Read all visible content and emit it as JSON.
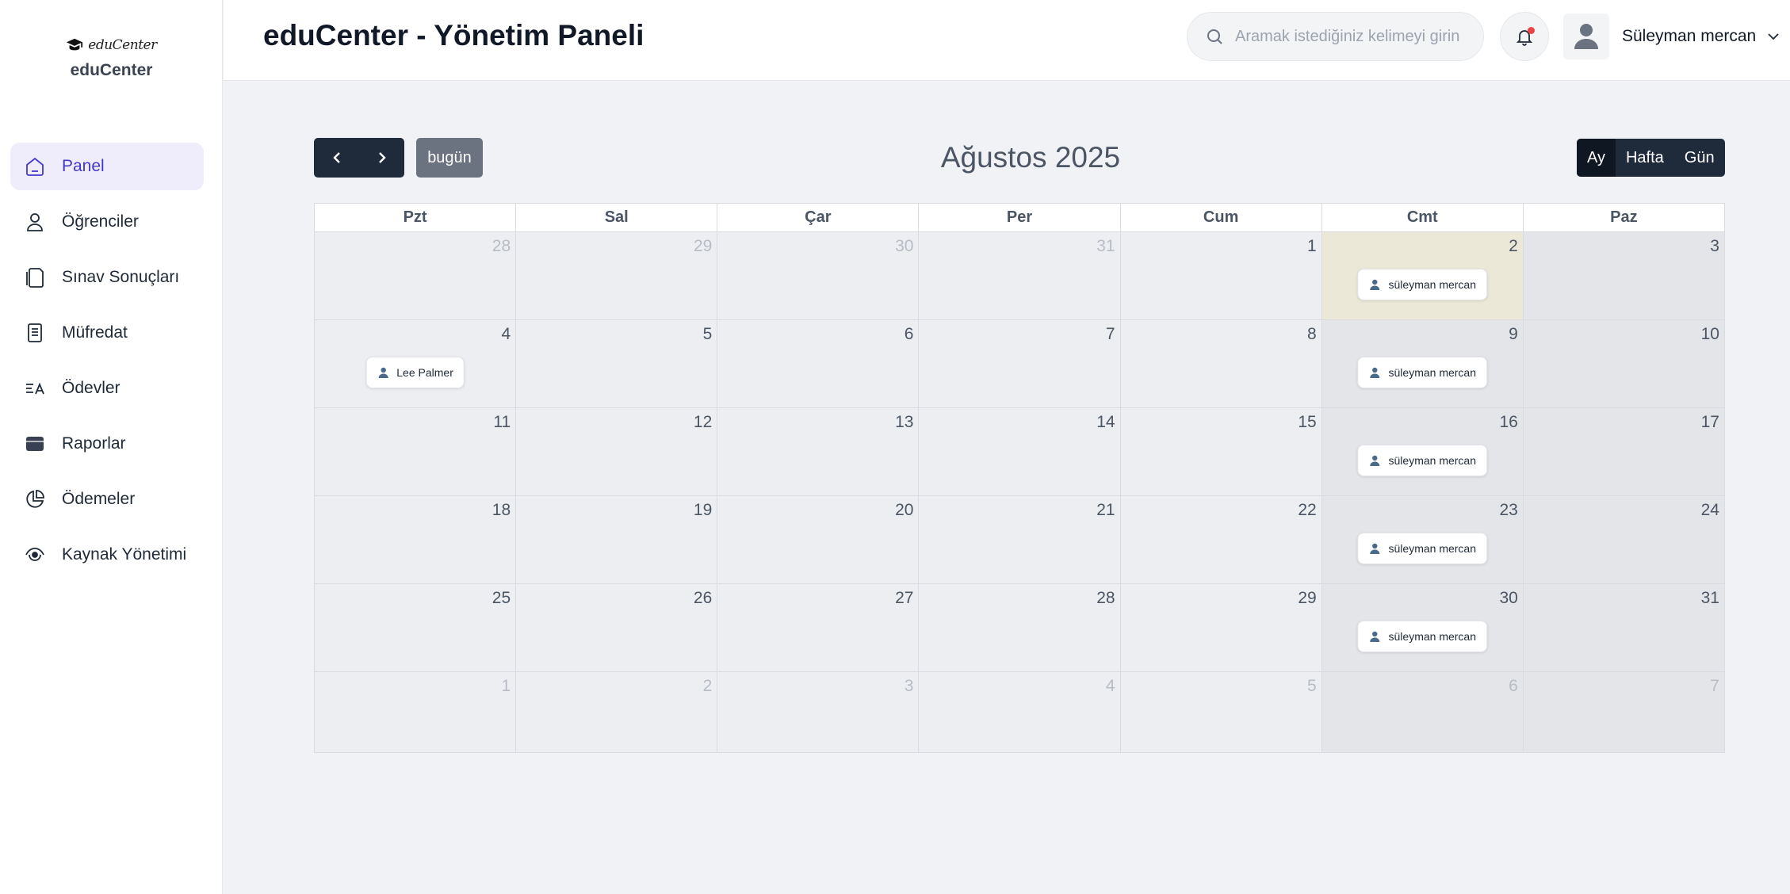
{
  "brand": {
    "script": "eduCenter",
    "name": "eduCenter"
  },
  "sidebar": {
    "items": [
      {
        "label": "Panel",
        "icon": "home-icon",
        "active": true
      },
      {
        "label": "Öğrenciler",
        "icon": "user-icon"
      },
      {
        "label": "Sınav Sonuçları",
        "icon": "clipboard-icon"
      },
      {
        "label": "Müfredat",
        "icon": "document-icon"
      },
      {
        "label": "Ödevler",
        "icon": "translate-icon"
      },
      {
        "label": "Raporlar",
        "icon": "report-icon"
      },
      {
        "label": "Ödemeler",
        "icon": "pie-chart-icon"
      },
      {
        "label": "Kaynak Yönetimi",
        "icon": "eye-icon"
      }
    ]
  },
  "header": {
    "title": "eduCenter - Yönetim Paneli",
    "search_placeholder": "Aramak istediğiniz kelimeyi girin",
    "user_name": "Süleyman mercan"
  },
  "calendar": {
    "title": "Ağustos 2025",
    "today_label": "bugün",
    "views": [
      "Ay",
      "Hafta",
      "Gün"
    ],
    "active_view": "Ay",
    "weekdays": [
      "Pzt",
      "Sal",
      "Çar",
      "Per",
      "Cum",
      "Cmt",
      "Paz"
    ],
    "weeks": [
      {
        "days": [
          "28",
          "29",
          "30",
          "31",
          "1",
          "2",
          "3"
        ],
        "other": [
          true,
          true,
          true,
          true,
          false,
          false,
          false
        ],
        "events": {
          "5": "süleyman mercan"
        }
      },
      {
        "days": [
          "4",
          "5",
          "6",
          "7",
          "8",
          "9",
          "10"
        ],
        "other": [
          false,
          false,
          false,
          false,
          false,
          false,
          false
        ],
        "events": {
          "0": "Lee Palmer",
          "5": "süleyman mercan"
        }
      },
      {
        "days": [
          "11",
          "12",
          "13",
          "14",
          "15",
          "16",
          "17"
        ],
        "other": [
          false,
          false,
          false,
          false,
          false,
          false,
          false
        ],
        "events": {
          "5": "süleyman mercan"
        }
      },
      {
        "days": [
          "18",
          "19",
          "20",
          "21",
          "22",
          "23",
          "24"
        ],
        "other": [
          false,
          false,
          false,
          false,
          false,
          false,
          false
        ],
        "events": {
          "5": "süleyman mercan"
        }
      },
      {
        "days": [
          "25",
          "26",
          "27",
          "28",
          "29",
          "30",
          "31"
        ],
        "other": [
          false,
          false,
          false,
          false,
          false,
          false,
          false
        ],
        "events": {
          "5": "süleyman mercan"
        }
      },
      {
        "days": [
          "1",
          "2",
          "3",
          "4",
          "5",
          "6",
          "7"
        ],
        "other": [
          true,
          true,
          true,
          true,
          true,
          true,
          true
        ],
        "events": {}
      }
    ],
    "highlight": {
      "week": 0,
      "day": 5
    }
  },
  "colors": {
    "accent": "#4338ca",
    "dark": "#1f2a3a",
    "today_bg": "#ebe8d8"
  }
}
